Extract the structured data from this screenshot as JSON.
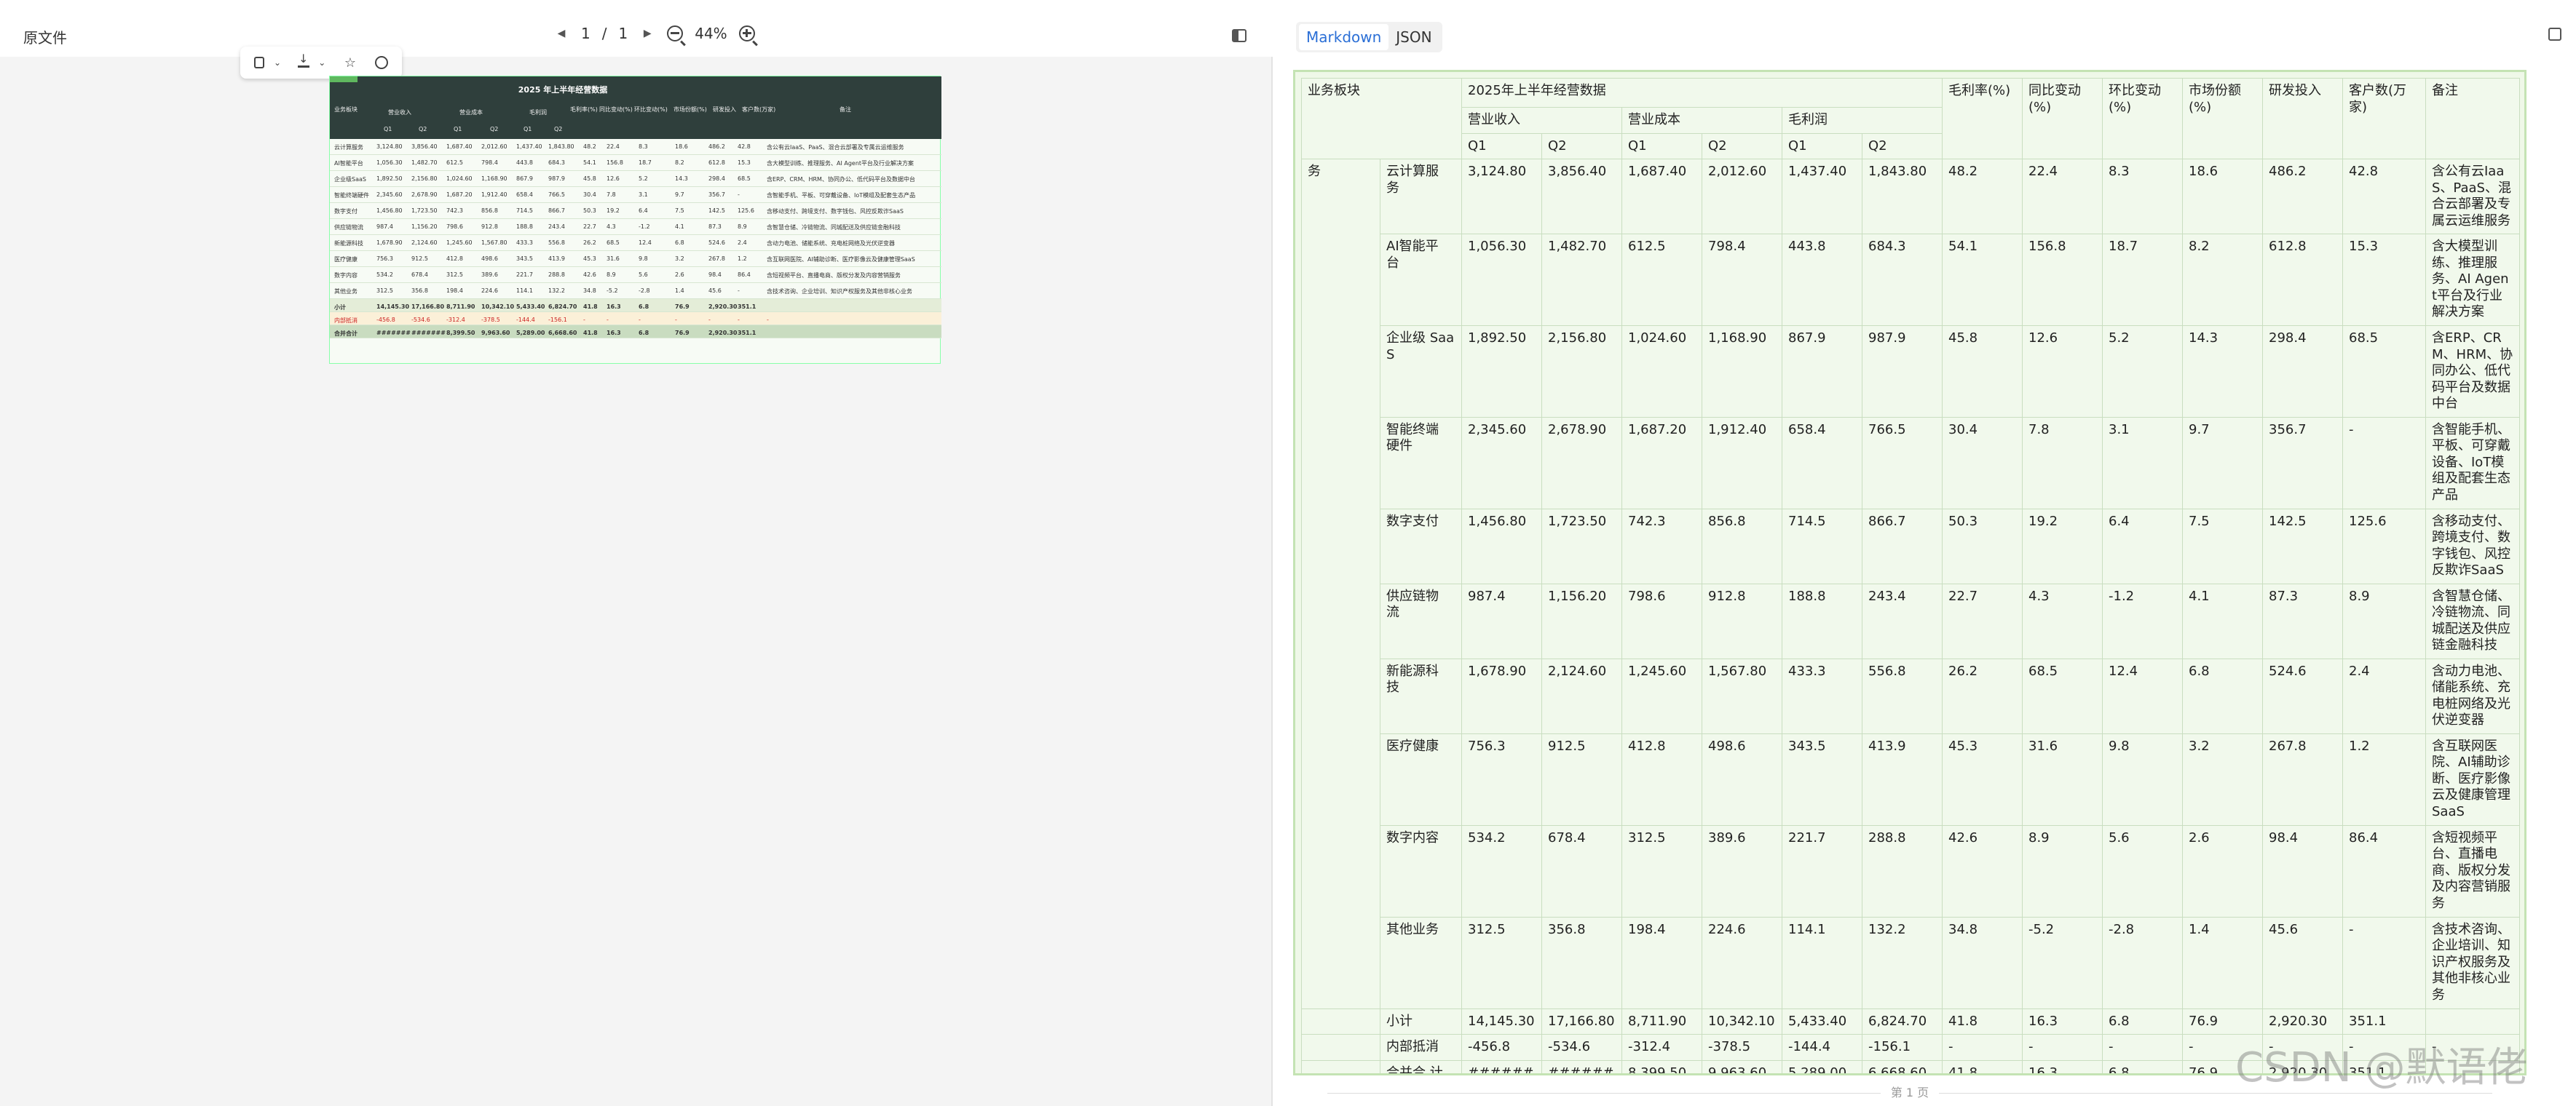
{
  "left": {
    "title": "原文件",
    "page_current": "1",
    "page_sep": "/",
    "page_total": "1",
    "zoom": "44%"
  },
  "right": {
    "tabs": [
      "Markdown",
      "JSON"
    ],
    "page_footer": "第 1 页"
  },
  "sheet": {
    "title": "2025年上半年经营数据",
    "col_sector": "业务板块",
    "col_revenue": "营业收入",
    "col_cost": "营业成本",
    "col_gross": "毛利润",
    "col_margin": "毛利率(%)",
    "col_yoy": "同比变动(%)",
    "col_qoq": "环比变动(%)",
    "col_share": "市场份额(%)",
    "col_rd": "研发投入",
    "col_clients": "客户数(万家)",
    "col_note": "备注",
    "q1": "Q1",
    "q2": "Q2",
    "group_label": "务",
    "rows": [
      [
        "云计算服 务",
        "3,124.80",
        "3,856.40",
        "1,687.40",
        "2,012.60",
        "1,437.40",
        "1,843.80",
        "48.2",
        "22.4",
        "8.3",
        "18.6",
        "486.2",
        "42.8",
        "含公有云IaaS、PaaS、混合云部署及专属云运维服务"
      ],
      [
        "AI智能平 台",
        "1,056.30",
        "1,482.70",
        "612.5",
        "798.4",
        "443.8",
        "684.3",
        "54.1",
        "156.8",
        "18.7",
        "8.2",
        "612.8",
        "15.3",
        "含大模型训练、推理服务、AI Agent平台及行业解决方案"
      ],
      [
        "企业级 SaaS",
        "1,892.50",
        "2,156.80",
        "1,024.60",
        "1,168.90",
        "867.9",
        "987.9",
        "45.8",
        "12.6",
        "5.2",
        "14.3",
        "298.4",
        "68.5",
        "含ERP、CRM、HRM、协同办公、低代码平台及数据中台"
      ],
      [
        "智能终端 硬件",
        "2,345.60",
        "2,678.90",
        "1,687.20",
        "1,912.40",
        "658.4",
        "766.5",
        "30.4",
        "7.8",
        "3.1",
        "9.7",
        "356.7",
        "-",
        "含智能手机、平板、可穿戴设备、IoT模组及配套生态产品"
      ],
      [
        "数字支付",
        "1,456.80",
        "1,723.50",
        "742.3",
        "856.8",
        "714.5",
        "866.7",
        "50.3",
        "19.2",
        "6.4",
        "7.5",
        "142.5",
        "125.6",
        "含移动支付、跨境支付、数字钱包、风控反欺诈SaaS"
      ],
      [
        "供应链物 流",
        "987.4",
        "1,156.20",
        "798.6",
        "912.8",
        "188.8",
        "243.4",
        "22.7",
        "4.3",
        "-1.2",
        "4.1",
        "87.3",
        "8.9",
        "含智慧仓储、冷链物流、同城配送及供应链金融科技"
      ],
      [
        "新能源科 技",
        "1,678.90",
        "2,124.60",
        "1,245.60",
        "1,567.80",
        "433.3",
        "556.8",
        "26.2",
        "68.5",
        "12.4",
        "6.8",
        "524.6",
        "2.4",
        "含动力电池、储能系统、充电桩网络及光伏逆变器"
      ],
      [
        "医疗健康",
        "756.3",
        "912.5",
        "412.8",
        "498.6",
        "343.5",
        "413.9",
        "45.3",
        "31.6",
        "9.8",
        "3.2",
        "267.8",
        "1.2",
        "含互联网医院、AI辅助诊断、医疗影像云及健康管理SaaS"
      ],
      [
        "数字内容",
        "534.2",
        "678.4",
        "312.5",
        "389.6",
        "221.7",
        "288.8",
        "42.6",
        "8.9",
        "5.6",
        "2.6",
        "98.4",
        "86.4",
        "含短视频平台、直播电商、版权分发及内容营销服务"
      ],
      [
        "其他业务",
        "312.5",
        "356.8",
        "198.4",
        "224.6",
        "114.1",
        "132.2",
        "34.8",
        "-5.2",
        "-2.8",
        "1.4",
        "45.6",
        "-",
        "含技术咨询、企业培训、知识产权服务及其他非核心业务"
      ]
    ],
    "subtotal": [
      "小计",
      "14,145.30",
      "17,166.80",
      "8,711.90",
      "10,342.10",
      "5,433.40",
      "6,824.70",
      "41.8",
      "16.3",
      "6.8",
      "76.9",
      "2,920.30",
      "351.1",
      ""
    ],
    "elimination": [
      "内部抵消",
      "-456.8",
      "-534.6",
      "-312.4",
      "-378.5",
      "-144.4",
      "-156.1",
      "-",
      "-",
      "-",
      "-",
      "-",
      "-",
      "-"
    ],
    "total": [
      "合并合 计",
      "#######",
      "#######",
      "8,399.50",
      "9,963.60",
      "5,289.00",
      "6,668.60",
      "41.8",
      "16.3",
      "6.8",
      "76.9",
      "2,920.30",
      "351.1",
      ""
    ]
  },
  "mini": {
    "title": "2025 年上半年经营数据",
    "col_sector": "业务板块",
    "col_revenue": "营业收入",
    "col_cost": "营业成本",
    "col_gross": "毛利润",
    "col_margin": "毛利率(%)",
    "col_yoy": "同比变动(%)",
    "col_qoq": "环比变动(%)",
    "col_share": "市场份额(%)",
    "col_rd": "研发投入",
    "col_clients": "客户数(万家)",
    "col_note": "备注",
    "row_names": [
      "云计算服务",
      "AI智能平台",
      "企业级SaaS",
      "智能终端硬件",
      "数字支付",
      "供应链物流",
      "新能源科技",
      "医疗健康",
      "数字内容",
      "其他业务"
    ],
    "subtotal_label": "小计",
    "elim_label": "内部抵消",
    "total_label": "合并合计"
  },
  "watermark": "CSDN @默语佬"
}
